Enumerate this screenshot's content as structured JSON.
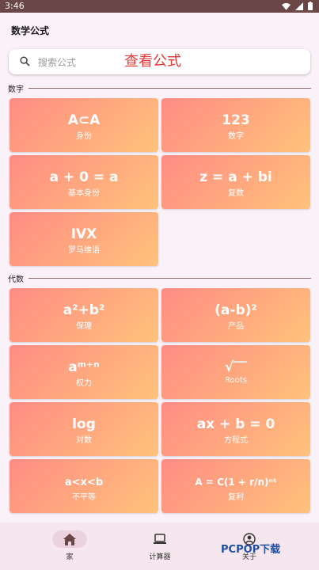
{
  "status": {
    "time": "3:46"
  },
  "appbar": {
    "title": "数学公式"
  },
  "search": {
    "placeholder": "搜索公式",
    "hint": "查看公式"
  },
  "sections": [
    {
      "label": "数字",
      "cards": [
        {
          "formula": "A⊂A",
          "subtitle": "身份"
        },
        {
          "formula": "123",
          "subtitle": "数字"
        },
        {
          "formula": "a + 0 = a",
          "subtitle": "基本身份"
        },
        {
          "formula": "z = a + bi",
          "subtitle": "复数"
        },
        {
          "formula": "IVX",
          "subtitle": "罗马维语"
        }
      ]
    },
    {
      "label": "代数",
      "cards": [
        {
          "formula": "a²+b²",
          "subtitle": "保理"
        },
        {
          "formula": "(a-b)²",
          "subtitle": "产品"
        },
        {
          "formula": "aᵐ⁺ⁿ",
          "subtitle": "权力"
        },
        {
          "formula": "√‾‾",
          "subtitle": "Roots"
        },
        {
          "formula": "log",
          "subtitle": "对数"
        },
        {
          "formula": "ax + b = 0",
          "subtitle": "方程式"
        },
        {
          "formula": "a<x<b",
          "subtitle": "不平等"
        },
        {
          "formula": "A = C(1 + r/n)ⁿᵗ",
          "subtitle": "复利"
        }
      ]
    }
  ],
  "nav": {
    "items": [
      {
        "label": "家"
      },
      {
        "label": "计算器"
      },
      {
        "label": "关于"
      }
    ]
  },
  "watermark": "PCPOP下载"
}
